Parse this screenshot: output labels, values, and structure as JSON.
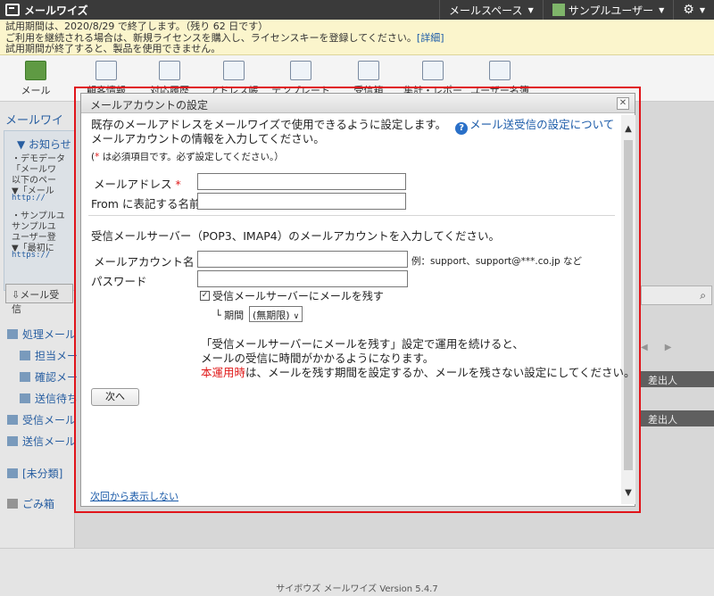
{
  "topbar": {
    "app_name": "メールワイズ",
    "mail_space": "メールスペース",
    "user_name": "サンプルユーザー"
  },
  "banner": {
    "line1": "試用期間は、2020/8/29 で終了します。（残り 62 日です）",
    "line2": "ご利用を継続される場合は、新規ライセンスを購入し、ライセンスキーを登録してください。",
    "detail_link": "[詳細]",
    "line3": "試用期間が終了すると、製品を使用できません。"
  },
  "toolbar": {
    "items": [
      "メール",
      "顧客情報",
      "対応履歴",
      "アドレス帳",
      "テンプレート",
      "受信箱",
      "集計・レポート",
      "ユーザー名簿"
    ]
  },
  "left_panel": {
    "title": "メールワイズ",
    "notice_head": "お知らせ",
    "notice_lines": [
      "・デモデータ",
      "「メールワ",
      "以下のペー",
      "▼「メール",
      "・サンプルユ",
      "サンプルユ",
      "ユーザー登",
      "▼「最初に"
    ],
    "notice_urls": [
      "http://",
      "https://"
    ],
    "receive_button": "メール受信",
    "folders": [
      "処理メール",
      "担当メー",
      "確認メー",
      "送信待ち",
      "受信メール",
      "送信メール",
      "[未分類]",
      "ごみ箱"
    ]
  },
  "right_panel": {
    "header1": "差出人",
    "header2": "差出人"
  },
  "footer": {
    "version": "サイボウズ メールワイズ Version 5.4.7"
  },
  "dialog": {
    "title": "メールアカウントの設定",
    "intro_line1": "既存のメールアドレスをメールワイズで使用できるように設定します。",
    "help_link": "メール送受信の設定について",
    "intro_line2": "メールアカウントの情報を入力してください。",
    "required_note": "は必須項目です。必ず設定してください。）",
    "required_mark": "*",
    "field_email_label": "メールアドレス",
    "field_from_label": "From に表記する名前",
    "section2": "受信メールサーバー（POP3、IMAP4）のメールアカウントを入力してください。",
    "field_account_label": "メールアカウント名",
    "account_example": "例：support、support@***.co.jp など",
    "field_password_label": "パスワード",
    "leave_on_server_label": "受信メールサーバーにメールを残す",
    "period_label": "└ 期間",
    "period_value": "(無期限)",
    "note_line1": "「受信メールサーバーにメールを残す」設定で運用を続けると、",
    "note_line2": "メールの受信に時間がかかるようになります。",
    "note_line3_em": "本運用時",
    "note_line3_rest": "は、メールを残す期間を設定するか、メールを残さない設定にしてください。",
    "next_button": "次へ",
    "dont_show_link": "次回から表示しない"
  },
  "colors": {
    "accent_red": "#e0141a",
    "link_blue": "#1a5aa8",
    "banner_bg": "#fbf5cc"
  }
}
